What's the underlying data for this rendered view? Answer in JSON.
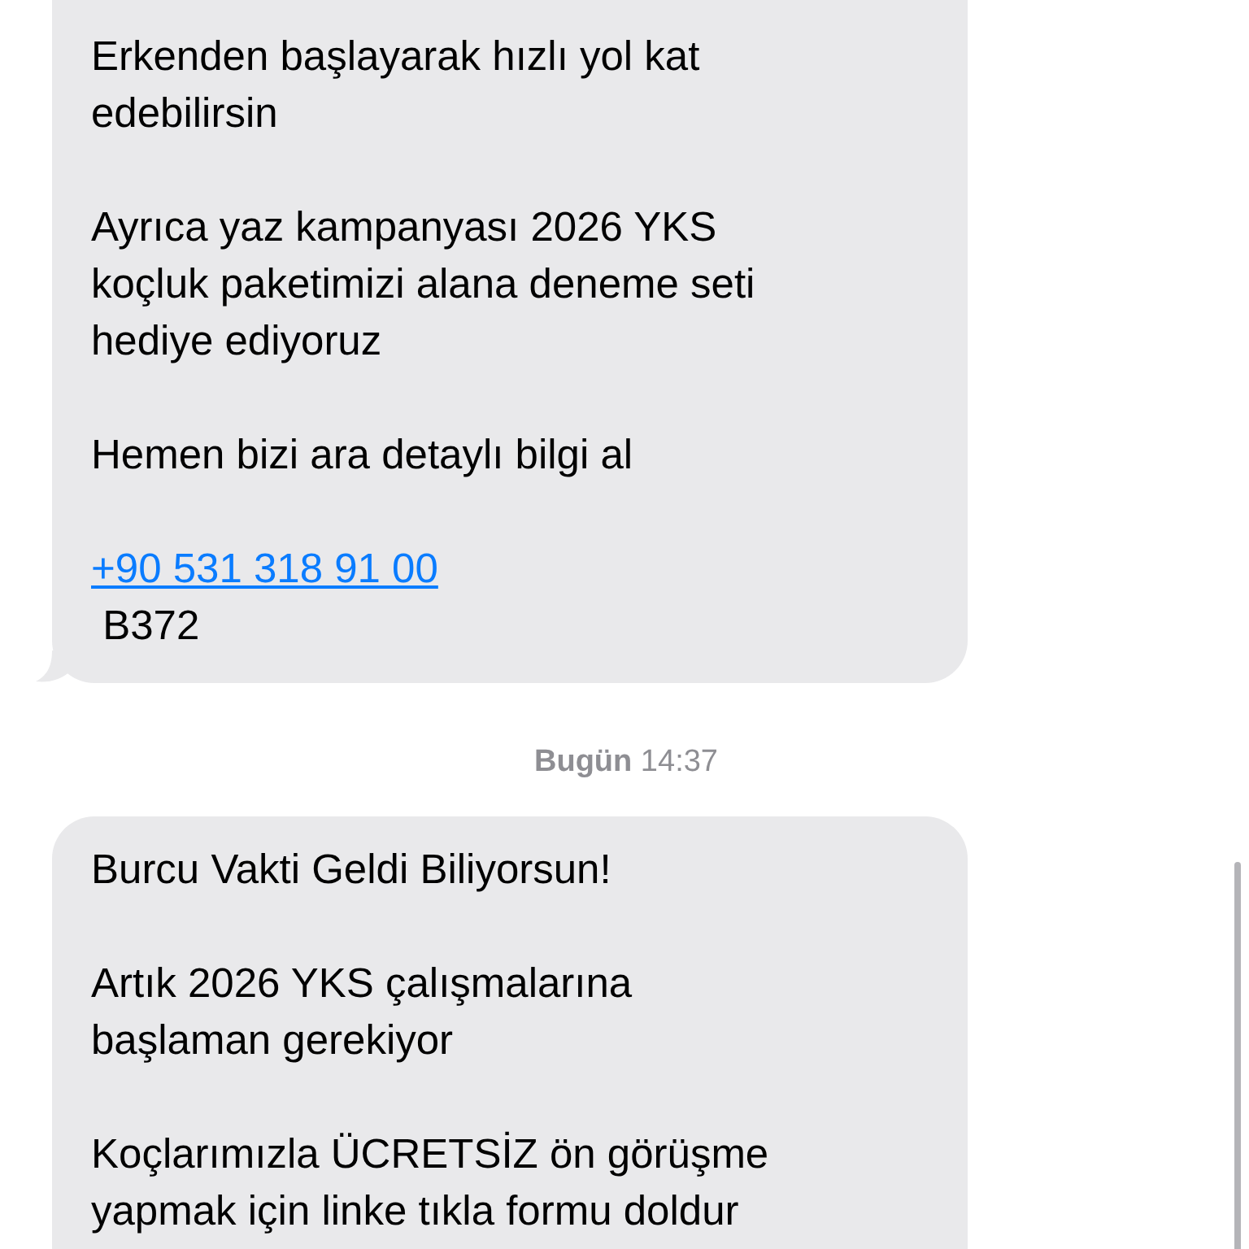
{
  "messages": [
    {
      "kind": "message",
      "tail": true,
      "paragraphs": [
        [
          "Erkenden başlayarak hızlı yol kat",
          "edebilirsin"
        ],
        [
          "Ayrıca yaz kampanyası 2026 YKS",
          "koçluk paketimizi alana deneme seti",
          "hediye ediyoruz"
        ],
        [
          "Hemen bizi ara detaylı bilgi al"
        ]
      ],
      "link": "+90 531 318 91 00",
      "footer": " B372"
    },
    {
      "kind": "timestamp",
      "day": "Bugün",
      "time": "14:37"
    },
    {
      "kind": "message",
      "paragraphs": [
        [
          "Burcu Vakti Geldi Biliyorsun!"
        ],
        [
          "Artık 2026 YKS çalışmalarına",
          "başlaman gerekiyor"
        ],
        [
          "Koçlarımızla ÜCRETSİZ ön görüşme",
          "yapmak için linke tıkla formu doldur"
        ]
      ]
    }
  ]
}
